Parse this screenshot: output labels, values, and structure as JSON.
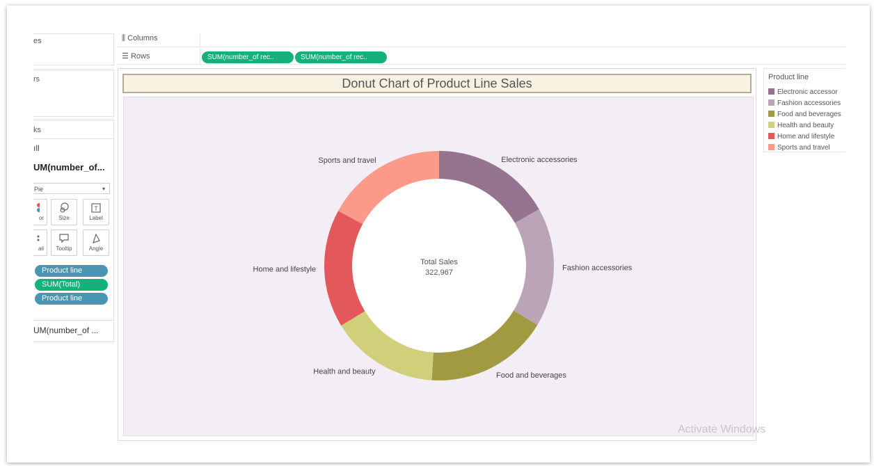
{
  "sidebar": {
    "pages_label": "es",
    "filters_label": "rs",
    "marks_label": "ks",
    "all_label": "ıll",
    "sum_title": "UM(number_of...",
    "mark_type": "Pie",
    "buttons": [
      {
        "icon": "color-icon",
        "label": "or"
      },
      {
        "icon": "size-icon",
        "label": "Size"
      },
      {
        "icon": "label-icon",
        "label": "Label"
      },
      {
        "icon": "detail-icon",
        "label": "ail"
      },
      {
        "icon": "tooltip-icon",
        "label": "Tooltip"
      },
      {
        "icon": "angle-icon",
        "label": "Angle"
      }
    ],
    "pills": [
      {
        "label": "Product line",
        "kind": "dimension"
      },
      {
        "label": "SUM(Total)",
        "kind": "measure"
      },
      {
        "label": "Product line",
        "kind": "dimension"
      }
    ],
    "sum2": "UM(number_of ..."
  },
  "shelves": {
    "columns_label": "Columns",
    "rows_label": "Rows",
    "row_pills": [
      "SUM(number_of rec..",
      "SUM(number_of rec.."
    ]
  },
  "chart": {
    "title": "Donut Chart of Product Line Sales",
    "center_label": "Total Sales",
    "center_value": "322,967"
  },
  "chart_data": {
    "type": "pie",
    "title": "Donut Chart of Product Line Sales",
    "total": 322967,
    "categories": [
      "Electronic accessories",
      "Fashion accessories",
      "Food and beverages",
      "Health and beauty",
      "Home and lifestyle",
      "Sports and travel"
    ],
    "values": [
      54338,
      54306,
      56145,
      49194,
      53862,
      55123
    ],
    "colors": [
      "#94748f",
      "#bba4b7",
      "#a19a40",
      "#d0cf7a",
      "#e3585b",
      "#fc9a8a"
    ]
  },
  "legend": {
    "title": "Product line",
    "items": [
      {
        "label": "Electronic accessor",
        "color": "#94748f"
      },
      {
        "label": "Fashion accessories",
        "color": "#bba4b7"
      },
      {
        "label": "Food and beverages",
        "color": "#a19a40"
      },
      {
        "label": "Health and beauty",
        "color": "#d0cf7a"
      },
      {
        "label": "Home and lifestyle",
        "color": "#e3585b"
      },
      {
        "label": "Sports and travel",
        "color": "#fc9a8a"
      }
    ]
  },
  "watermark": "Activate Windows"
}
